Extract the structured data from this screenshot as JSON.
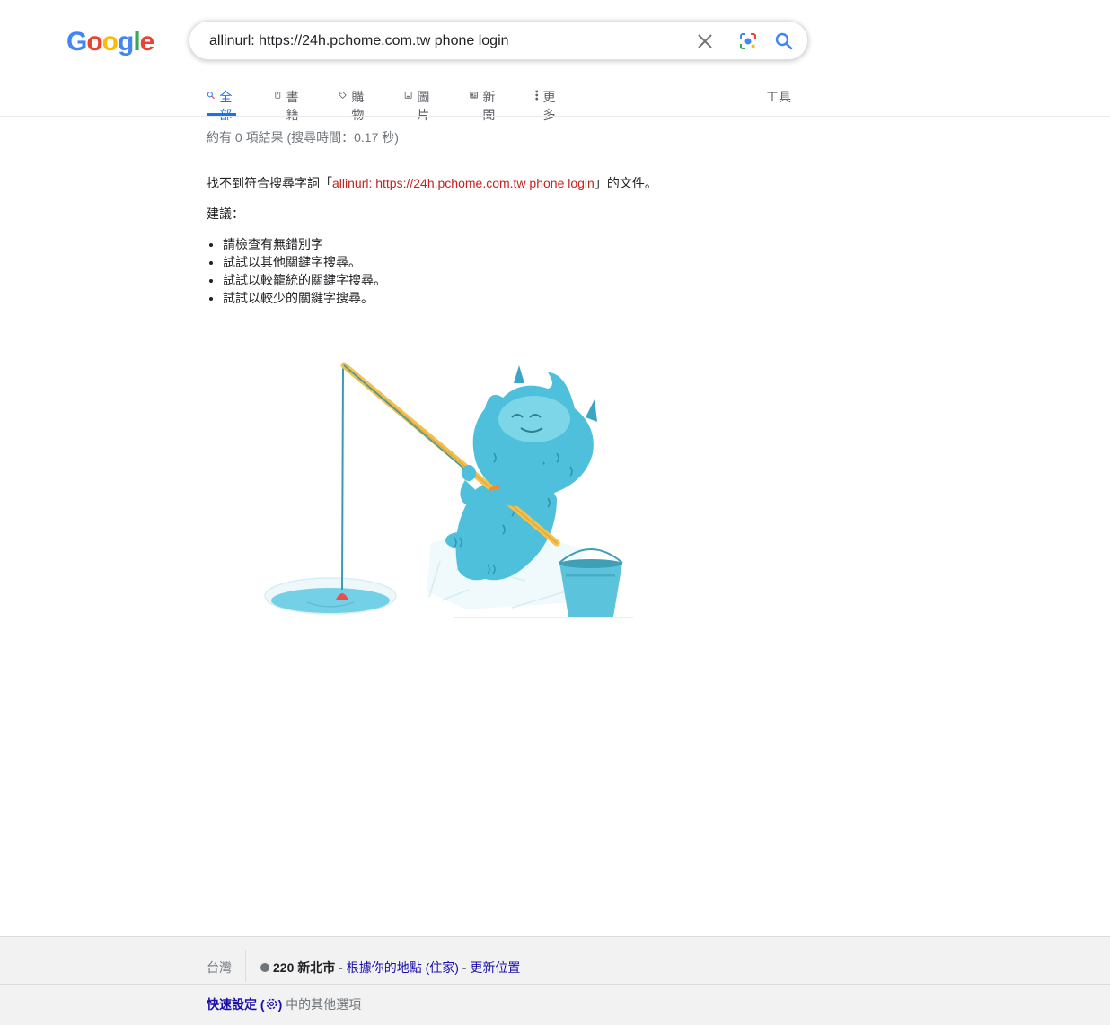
{
  "logo": {
    "letters": [
      "G",
      "o",
      "o",
      "g",
      "l",
      "e"
    ],
    "colors": [
      "#4285f4",
      "#ea4335",
      "#fbbc05",
      "#4285f4",
      "#34a853",
      "#ea4335"
    ]
  },
  "search": {
    "value": "allinurl: https://24h.pchome.com.tw phone login"
  },
  "tabs": [
    {
      "label": "全部",
      "icon": "search-icon",
      "active": true
    },
    {
      "label": "書籍",
      "icon": "book-icon"
    },
    {
      "label": "購物",
      "icon": "tag-icon"
    },
    {
      "label": "圖片",
      "icon": "image-icon"
    },
    {
      "label": "新聞",
      "icon": "news-icon"
    },
    {
      "label": "更多",
      "icon": "more-vert-icon"
    }
  ],
  "tools_label": "工具",
  "stats": "約有 0 項結果 (搜尋時間：0.17 秒)",
  "no_results": {
    "prefix": "找不到符合搜尋字詞「",
    "query": "allinurl: https://24h.pchome.com.tw phone login",
    "suffix": "」的文件。"
  },
  "suggestions": {
    "title": "建議：",
    "items": [
      "請檢查有無錯別字",
      "試試以其他關鍵字搜尋。",
      "試試以較籠統的關鍵字搜尋。",
      "試試以較少的關鍵字搜尋。"
    ]
  },
  "footer": {
    "country": "台灣",
    "location": "220 新北市",
    "sep1": " - ",
    "based_on": "根據你的地點 (住家)",
    "sep2": " - ",
    "update": "更新位置",
    "quick_settings": "快速設定 (",
    "quick_settings_close": ")",
    "more_options": " 中的其他選項"
  },
  "accent_colors": {
    "blue": "#1a73e8",
    "link": "#1a0dab",
    "query_red": "#c5221f"
  }
}
